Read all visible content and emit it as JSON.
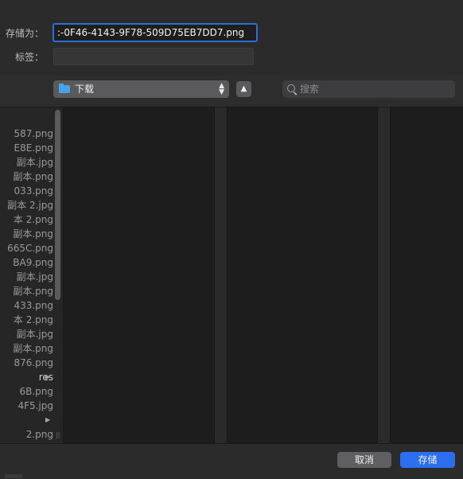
{
  "save_as": {
    "label": "存储为：",
    "value": ":-0F46-4143-9F78-509D75EB7DD7.png"
  },
  "tags": {
    "label": "标签：",
    "value": ""
  },
  "location": {
    "label": "下载",
    "icon": "downloads-folder-icon"
  },
  "search": {
    "placeholder": "搜索",
    "icon": "search-icon"
  },
  "files": [
    {
      "name": "587.png",
      "has_children": false
    },
    {
      "name": "E8E.png",
      "has_children": false
    },
    {
      "name": "副本.jpg",
      "has_children": false
    },
    {
      "name": "副本.png",
      "has_children": false
    },
    {
      "name": "033.png",
      "has_children": false
    },
    {
      "name": "副本 2.jpg",
      "has_children": false
    },
    {
      "name": "本 2.png",
      "has_children": false
    },
    {
      "name": "副本.png",
      "has_children": false
    },
    {
      "name": "665C.png",
      "has_children": false
    },
    {
      "name": "BA9.png",
      "has_children": false
    },
    {
      "name": "副本.jpg",
      "has_children": false
    },
    {
      "name": "副本.png",
      "has_children": false
    },
    {
      "name": "433.png",
      "has_children": false
    },
    {
      "name": "本 2.png",
      "has_children": false
    },
    {
      "name": "副本.jpg",
      "has_children": false
    },
    {
      "name": "副本.png",
      "has_children": false
    },
    {
      "name": "876.png",
      "has_children": false
    },
    {
      "name": "res",
      "has_children": true
    },
    {
      "name": "6B.png",
      "has_children": false
    },
    {
      "name": "4F5.jpg",
      "has_children": false
    },
    {
      "name": "",
      "has_children": true
    },
    {
      "name": "2.png",
      "has_children": false
    }
  ],
  "buttons": {
    "cancel": "取消",
    "save": "存储"
  },
  "colors": {
    "accent": "#2b6ef0",
    "focus_ring": "#2a6fd1",
    "folder": "#4aa3e8"
  }
}
